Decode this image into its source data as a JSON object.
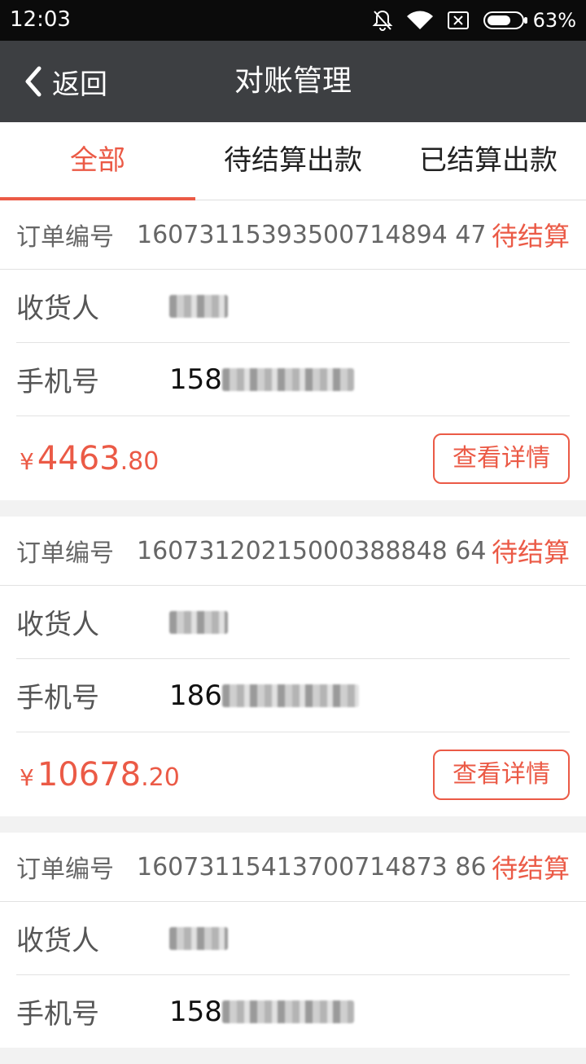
{
  "status_bar": {
    "time": "12:03",
    "battery_percent": "63%",
    "icons": [
      "bell-mute-icon",
      "wifi-icon",
      "sim-x-icon",
      "battery-icon"
    ]
  },
  "header": {
    "back_label": "返回",
    "title": "对账管理"
  },
  "tabs": [
    {
      "label": "全部",
      "active": true
    },
    {
      "label": "待结算出款",
      "active": false
    },
    {
      "label": "已结算出款",
      "active": false
    }
  ],
  "labels": {
    "order_no": "订单编号",
    "receiver": "收货人",
    "phone": "手机号",
    "currency": "¥",
    "detail_button": "查看详情"
  },
  "orders": [
    {
      "order_no": "16073115393500714894 47",
      "status": "待结算",
      "phone_prefix": "158",
      "price_int": "4463",
      "price_dec": ".80"
    },
    {
      "order_no": "16073120215000388848 64",
      "status": "待结算",
      "phone_prefix": "186",
      "price_int": "10678",
      "price_dec": ".20"
    },
    {
      "order_no": "16073115413700714873 86",
      "status": "待结算",
      "phone_prefix": "158",
      "price_int": "",
      "price_dec": ""
    }
  ],
  "accent_color": "#eb5a46"
}
